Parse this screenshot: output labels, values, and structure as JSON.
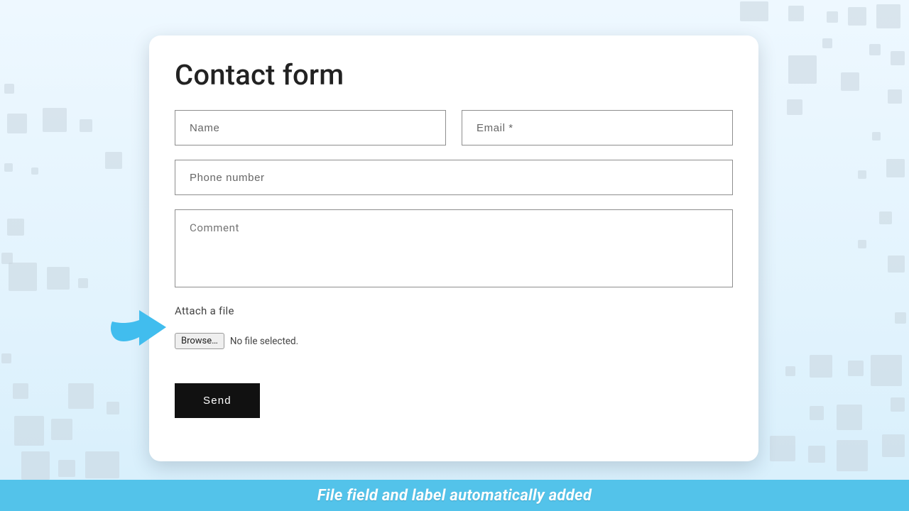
{
  "form": {
    "title": "Contact form",
    "name_placeholder": "Name",
    "email_placeholder": "Email *",
    "phone_placeholder": "Phone number",
    "comment_placeholder": "Comment",
    "attach_label": "Attach a file",
    "browse_label": "Browse…",
    "no_file_text": "No file selected.",
    "send_label": "Send"
  },
  "banner": {
    "text": "File field and label automatically added"
  },
  "colors": {
    "accent_arrow": "#41bdee",
    "banner_bg": "#53c3ea",
    "send_bg": "#111111"
  }
}
